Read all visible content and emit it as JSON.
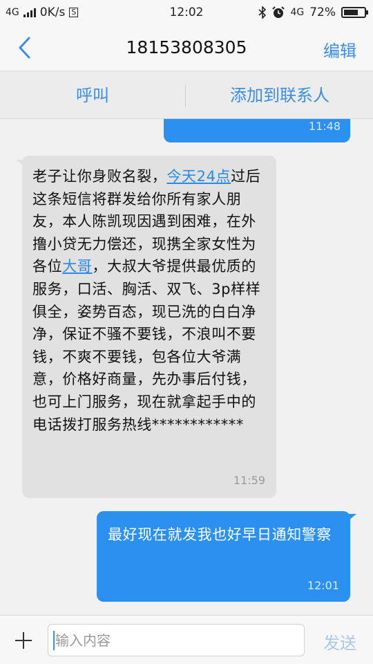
{
  "status_bar": {
    "network": "4G",
    "speed": "0K/s",
    "time": "12:02",
    "network_right": "4G",
    "battery": "72%",
    "battery_level": 0.72
  },
  "header": {
    "back_icon": "chevron-left-icon",
    "title": "18153808305",
    "edit": "编辑"
  },
  "actions": {
    "call": "呼叫",
    "add_contact": "添加到联系人"
  },
  "messages": [
    {
      "direction": "out",
      "time": "11:48"
    },
    {
      "direction": "in",
      "parts": [
        "老子让你身败名裂，",
        "今天24点",
        "过后这条短信将群发给你所有家人朋友，本人陈凯现因遇到困难，在外撸小贷无力偿还，现携全家女性为各位",
        "大哥",
        "，大叔大爷提供最优质的服务，口活、胸活、双飞、3p样样俱全，姿势百态，现已洗的白白净净，保证不骚不要钱，不浪叫不要钱，不爽不要钱，包各位大爷满意，价格好商量，先办事后付钱，也可上门服务，现在就拿起手中的电话拨打服务热线************"
      ],
      "time": "11:59"
    },
    {
      "direction": "out",
      "text": "最好现在就发我也好早日通知警察",
      "time": "12:01"
    }
  ],
  "composer": {
    "placeholder": "输入内容",
    "value": "",
    "send": "发送"
  },
  "colors": {
    "accent": "#3a8ee6",
    "outgoing_bubble": "#2b91f0",
    "incoming_bubble": "#e1e1e1"
  }
}
